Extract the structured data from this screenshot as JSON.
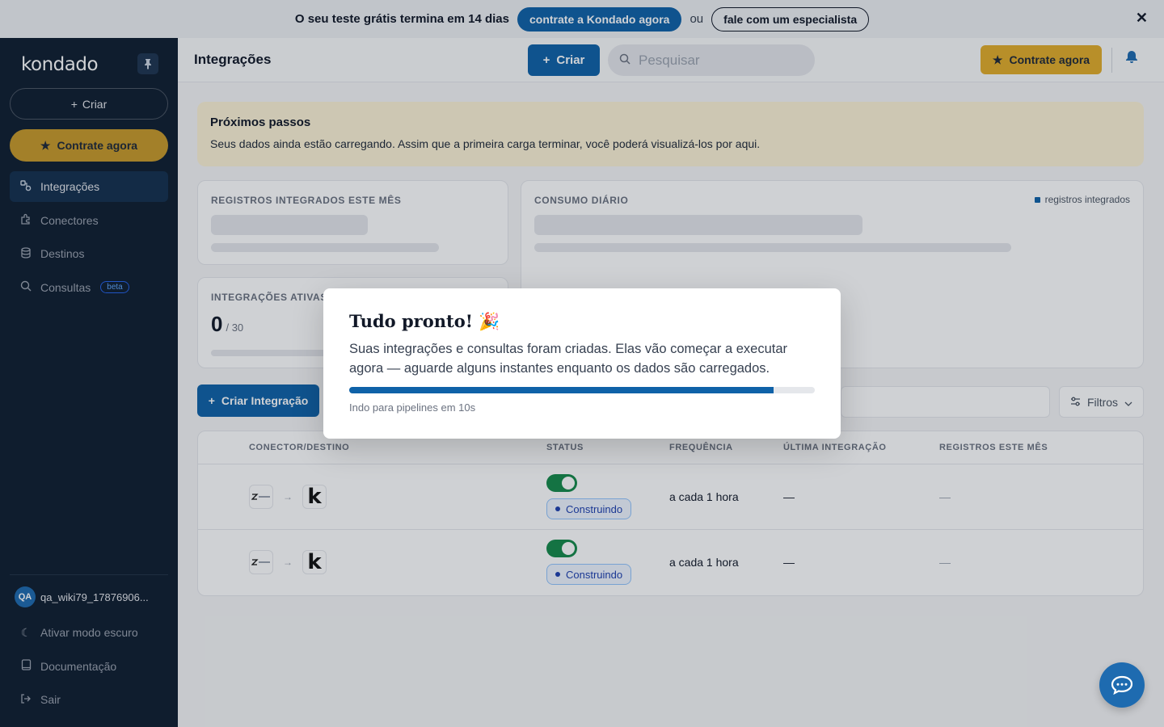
{
  "trial_banner": {
    "text": "O seu teste grátis termina em 14 dias",
    "primary_cta": "contrate a Kondado agora",
    "or": "ou",
    "secondary_cta": "fale com um especialista",
    "close_icon": "✕"
  },
  "sidebar": {
    "logo": "kondado",
    "pin_icon": "pin-icon",
    "create_label": "Criar",
    "cta_label": "Contrate agora",
    "items": [
      {
        "label": "Integrações",
        "icon": "integrations-icon",
        "active": true
      },
      {
        "label": "Conectores",
        "icon": "puzzle-icon"
      },
      {
        "label": "Destinos",
        "icon": "database-icon"
      },
      {
        "label": "Consultas",
        "icon": "search-icon",
        "badge": "beta"
      }
    ],
    "user": {
      "initials": "QA",
      "name": "qa_wiki79_17876906..."
    },
    "bottom_items": [
      {
        "label": "Ativar modo escuro",
        "icon": "moon-icon"
      },
      {
        "label": "Documentação",
        "icon": "book-icon"
      },
      {
        "label": "Sair",
        "icon": "logout-icon"
      }
    ]
  },
  "header": {
    "title": "Integrações",
    "create_label": "Criar",
    "search_placeholder": "Pesquisar",
    "cta_label": "Contrate agora",
    "bell_icon": "bell-icon"
  },
  "next_steps": {
    "title": "Próximos passos",
    "text": "Seus dados ainda estão carregando. Assim que a primeira carga terminar, você poderá visualizá-los por aqui."
  },
  "cards": {
    "records": {
      "label": "REGISTROS INTEGRADOS ESTE MÊS"
    },
    "daily": {
      "label": "CONSUMO DIÁRIO",
      "legend": "registros integrados"
    },
    "active": {
      "label": "INTEGRAÇÕES ATIVAS",
      "value": "0",
      "total": "/ 30"
    }
  },
  "toolbar": {
    "create_integration": "Criar Integração",
    "filters": "Filtros"
  },
  "table": {
    "columns": [
      "CONECTOR/DESTINO",
      "STATUS",
      "FREQUÊNCIA",
      "ÚLTIMA INTEGRAÇÃO",
      "REGISTROS ESTE MÊS"
    ],
    "rows": [
      {
        "status": "Construindo",
        "frequency": "a cada 1 hora",
        "last": "—",
        "records": "—",
        "enabled": true
      },
      {
        "status": "Construindo",
        "frequency": "a cada 1 hora",
        "last": "—",
        "records": "—",
        "enabled": true
      }
    ]
  },
  "modal": {
    "title": "Tudo pronto! 🎉",
    "body": "Suas integrações e consultas foram criadas. Elas vão começar a executar agora — aguarde alguns instantes enquanto os dados são carregados.",
    "progress_fraction": 0.912,
    "redirect_text": "Indo para pipelines em 10s"
  },
  "chat_icon": "chat-icon"
}
